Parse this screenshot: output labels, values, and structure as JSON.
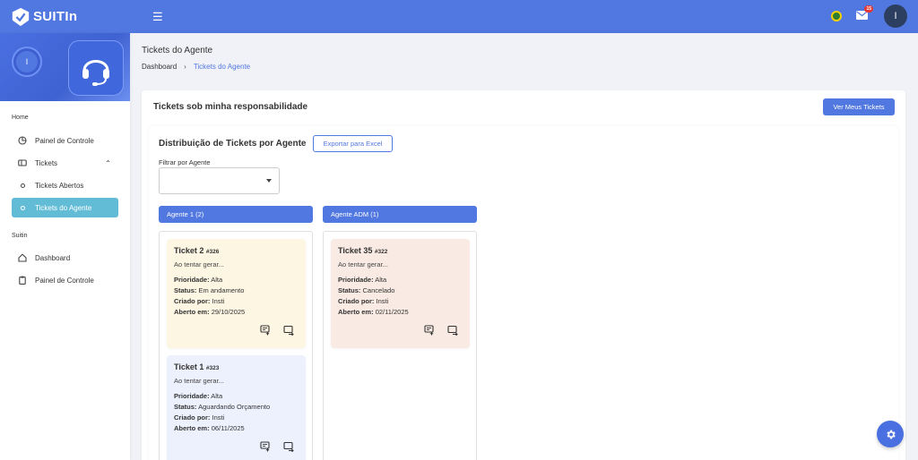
{
  "app": {
    "brand": "SUITIn",
    "user_initial": "I",
    "mail_count": "15"
  },
  "sidebar": {
    "user_initial": "I",
    "sections": [
      {
        "label": "Home"
      },
      {
        "label": "Suitin"
      }
    ],
    "items": [
      {
        "label": "Painel de Controle",
        "icon": "chart-pie-icon"
      },
      {
        "label": "Tickets",
        "icon": "ticket-icon"
      },
      {
        "label": "Tickets Abertos",
        "icon": "dot-icon"
      },
      {
        "label": "Tickets do Agente",
        "icon": "dot-icon"
      },
      {
        "label": "Dashboard",
        "icon": "home-icon"
      },
      {
        "label": "Painel de Controle",
        "icon": "clipboard-icon"
      }
    ]
  },
  "page": {
    "title": "Tickets do Agente",
    "breadcrumb": {
      "home": "Dashboard",
      "separator": "›",
      "current": "Tickets do Agente"
    }
  },
  "card": {
    "title": "Tickets sob minha responsabilidade",
    "button": "Ver Meus Tickets",
    "dist_title": "Distribuição de Tickets por Agente",
    "export_button": "Exportar para Excel",
    "filter_label": "Filtrar por Agente",
    "filter_value": ""
  },
  "columns": [
    {
      "header": "Agente 1 (2)",
      "tickets": [
        {
          "title": "Ticket 2",
          "number": "#326",
          "desc": "Ao tentar gerar...",
          "priority_label": "Prioridade:",
          "priority": "Alta",
          "status_label": "Status:",
          "status": "Em andamento",
          "created_label": "Criado por:",
          "created_by": "Insti",
          "opened_label": "Aberto em:",
          "opened": "29/10/2025",
          "bg": "#fdf6e3"
        },
        {
          "title": "Ticket 1",
          "number": "#323",
          "desc": "Ao tentar gerar...",
          "priority_label": "Prioridade:",
          "priority": "Alta",
          "status_label": "Status:",
          "status": "Aguardando Orçamento",
          "created_label": "Criado por:",
          "created_by": "Insti",
          "opened_label": "Aberto em:",
          "opened": "06/11/2025",
          "bg": "#edf1fd"
        }
      ]
    },
    {
      "header": "Agente ADM (1)",
      "tickets": [
        {
          "title": "Ticket 35",
          "number": "#322",
          "desc": "Ao tentar gerar...",
          "priority_label": "Prioridade:",
          "priority": "Alta",
          "status_label": "Status:",
          "status": "Cancelado",
          "created_label": "Criado por:",
          "created_by": "Insti",
          "opened_label": "Aberto em:",
          "opened": "02/11/2025",
          "bg": "#f9ebe3"
        }
      ]
    }
  ],
  "colors": {
    "accent": "#5177e0",
    "active_item": "#62bcd6"
  }
}
